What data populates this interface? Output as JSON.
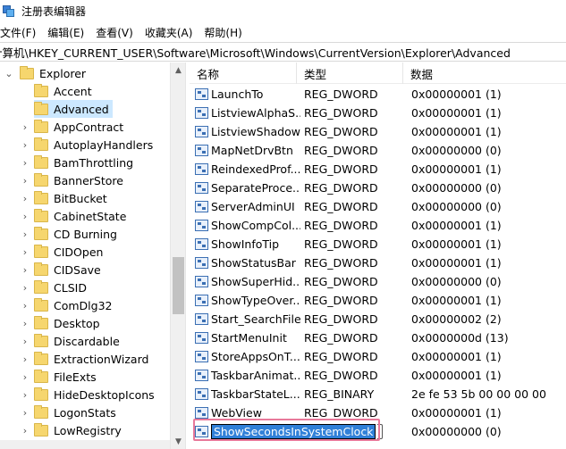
{
  "window": {
    "title": "注册表编辑器"
  },
  "menu": [
    "文件(F)",
    "编辑(E)",
    "查看(V)",
    "收藏夹(A)",
    "帮助(H)"
  ],
  "address": "计算机\\HKEY_CURRENT_USER\\Software\\Microsoft\\Windows\\CurrentVersion\\Explorer\\Advanced",
  "tree": {
    "parent": "Explorer",
    "items": [
      "Accent",
      "Advanced",
      "AppContract",
      "AutoplayHandlers",
      "BamThrottling",
      "BannerStore",
      "BitBucket",
      "CabinetState",
      "CD Burning",
      "CIDOpen",
      "CIDSave",
      "CLSID",
      "ComDlg32",
      "Desktop",
      "Discardable",
      "ExtractionWizard",
      "FileExts",
      "HideDesktopIcons",
      "LogonStats",
      "LowRegistry"
    ],
    "selected_index": 1
  },
  "list": {
    "columns": [
      "名称",
      "类型",
      "数据"
    ],
    "rows": [
      {
        "name": "LaunchTo",
        "type": "REG_DWORD",
        "data": "0x00000001 (1)"
      },
      {
        "name": "ListviewAlphaS...",
        "type": "REG_DWORD",
        "data": "0x00000001 (1)"
      },
      {
        "name": "ListviewShadow",
        "type": "REG_DWORD",
        "data": "0x00000001 (1)"
      },
      {
        "name": "MapNetDrvBtn",
        "type": "REG_DWORD",
        "data": "0x00000000 (0)"
      },
      {
        "name": "ReindexedProf...",
        "type": "REG_DWORD",
        "data": "0x00000001 (1)"
      },
      {
        "name": "SeparateProce...",
        "type": "REG_DWORD",
        "data": "0x00000000 (0)"
      },
      {
        "name": "ServerAdminUI",
        "type": "REG_DWORD",
        "data": "0x00000000 (0)"
      },
      {
        "name": "ShowCompCol...",
        "type": "REG_DWORD",
        "data": "0x00000001 (1)"
      },
      {
        "name": "ShowInfoTip",
        "type": "REG_DWORD",
        "data": "0x00000001 (1)"
      },
      {
        "name": "ShowStatusBar",
        "type": "REG_DWORD",
        "data": "0x00000001 (1)"
      },
      {
        "name": "ShowSuperHid...",
        "type": "REG_DWORD",
        "data": "0x00000000 (0)"
      },
      {
        "name": "ShowTypeOver...",
        "type": "REG_DWORD",
        "data": "0x00000001 (1)"
      },
      {
        "name": "Start_SearchFiles",
        "type": "REG_DWORD",
        "data": "0x00000002 (2)"
      },
      {
        "name": "StartMenuInit",
        "type": "REG_DWORD",
        "data": "0x0000000d (13)"
      },
      {
        "name": "StoreAppsOnT...",
        "type": "REG_DWORD",
        "data": "0x00000001 (1)"
      },
      {
        "name": "TaskbarAnimat...",
        "type": "REG_DWORD",
        "data": "0x00000001 (1)"
      },
      {
        "name": "TaskbarStateL...",
        "type": "REG_BINARY",
        "data": "2e fe 53 5b 00 00 00 00"
      },
      {
        "name": "WebView",
        "type": "REG_DWORD",
        "data": "0x00000001 (1)"
      }
    ],
    "editing": {
      "name": "ShowSecondsInSystemClock",
      "type": "",
      "data": "0x00000000 (0)"
    }
  },
  "colors": {
    "selection": "#cce8ff",
    "edit_highlight": "#3080d8",
    "annotation_border": "#e8799a"
  }
}
